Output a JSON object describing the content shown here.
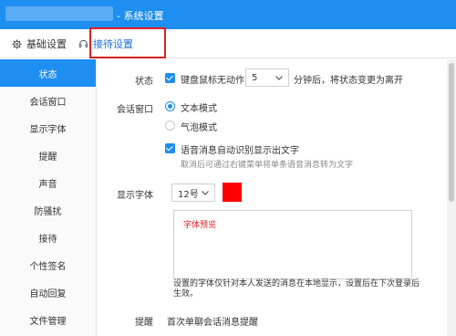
{
  "window": {
    "title": "- 系统设置"
  },
  "tabs": [
    {
      "label": "基础设置",
      "icon": "gear-icon"
    },
    {
      "label": "接待设置",
      "icon": "headset-icon"
    }
  ],
  "sidebar": {
    "items": [
      {
        "label": "状态",
        "active": true
      },
      {
        "label": "会话窗口"
      },
      {
        "label": "显示字体"
      },
      {
        "label": "提醒"
      },
      {
        "label": "声音"
      },
      {
        "label": "防骚扰"
      },
      {
        "label": "接待"
      },
      {
        "label": "个性签名"
      },
      {
        "label": "自动回复"
      },
      {
        "label": "文件管理"
      }
    ]
  },
  "status": {
    "label": "状态",
    "idle_checkbox_label": "键盘鼠标无动作",
    "idle_checked": true,
    "minutes_value": "5",
    "suffix": "分钟后，将状态变更为离开"
  },
  "session": {
    "label": "会话窗口",
    "options": [
      "文本模式",
      "气泡模式"
    ],
    "selected": "文本模式",
    "voice_checkbox_label": "语音消息自动识别显示出文字",
    "voice_checked": true,
    "voice_hint": "取消后可通过右键菜单将单条语音消息转为文字"
  },
  "font": {
    "label": "显示字体",
    "size_value": "12号",
    "color": "#ff0000",
    "preview_text": "字体预览",
    "note": "设置的字体仅针对本人发送的消息在本地显示，设置后在下次登录后生效。"
  },
  "reminder": {
    "label": "提醒",
    "text": "首次单聊会话消息提醒"
  },
  "colors": {
    "accent": "#1e8ef1",
    "highlight": "#e02020"
  }
}
